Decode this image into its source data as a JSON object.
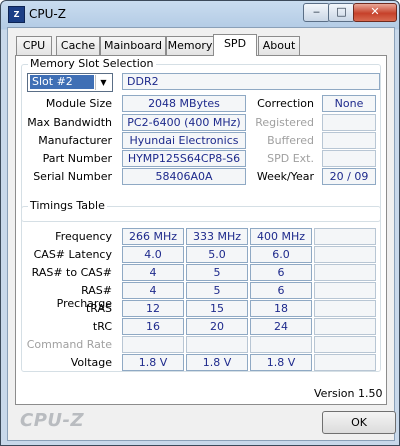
{
  "window": {
    "title": "CPU-Z",
    "app_icon": "cpu-z-icon",
    "minimize": "minimize-icon",
    "maximize": "maximize-icon",
    "close": "close-icon"
  },
  "tabs": [
    {
      "label": "CPU",
      "active": false
    },
    {
      "label": "Cache",
      "active": false
    },
    {
      "label": "Mainboard",
      "active": false
    },
    {
      "label": "Memory",
      "active": false
    },
    {
      "label": "SPD",
      "active": true
    },
    {
      "label": "About",
      "active": false
    }
  ],
  "slot": {
    "group_title": "Memory Slot Selection",
    "selected": "Slot #2",
    "type": "DDR2",
    "module_size_label": "Module Size",
    "module_size": "2048 MBytes",
    "max_bandwidth_label": "Max Bandwidth",
    "max_bandwidth": "PC2-6400 (400 MHz)",
    "manufacturer_label": "Manufacturer",
    "manufacturer": "Hyundai Electronics",
    "part_number_label": "Part Number",
    "part_number": "HYMP125S64CP8-S6",
    "serial_number_label": "Serial Number",
    "serial_number": "58406A0A",
    "correction_label": "Correction",
    "correction": "None",
    "registered_label": "Registered",
    "registered": "",
    "buffered_label": "Buffered",
    "buffered": "",
    "spd_ext_label": "SPD Ext.",
    "spd_ext": "",
    "week_year_label": "Week/Year",
    "week_year": "20 / 09"
  },
  "timings": {
    "group_title": "Timings Table",
    "rows": [
      {
        "label": "Frequency",
        "dim": false,
        "values": [
          "266 MHz",
          "333 MHz",
          "400 MHz",
          ""
        ]
      },
      {
        "label": "CAS# Latency",
        "dim": false,
        "values": [
          "4.0",
          "5.0",
          "6.0",
          ""
        ]
      },
      {
        "label": "RAS# to CAS#",
        "dim": false,
        "values": [
          "4",
          "5",
          "6",
          ""
        ]
      },
      {
        "label": "RAS# Precharge",
        "dim": false,
        "values": [
          "4",
          "5",
          "6",
          ""
        ]
      },
      {
        "label": "tRAS",
        "dim": false,
        "values": [
          "12",
          "15",
          "18",
          ""
        ]
      },
      {
        "label": "tRC",
        "dim": false,
        "values": [
          "16",
          "20",
          "24",
          ""
        ]
      },
      {
        "label": "Command Rate",
        "dim": true,
        "values": [
          "",
          "",
          "",
          ""
        ]
      },
      {
        "label": "Voltage",
        "dim": false,
        "values": [
          "1.8 V",
          "1.8 V",
          "1.8 V",
          ""
        ]
      }
    ]
  },
  "footer": {
    "version": "Version 1.50",
    "logo": "CPU-Z",
    "ok": "OK"
  }
}
